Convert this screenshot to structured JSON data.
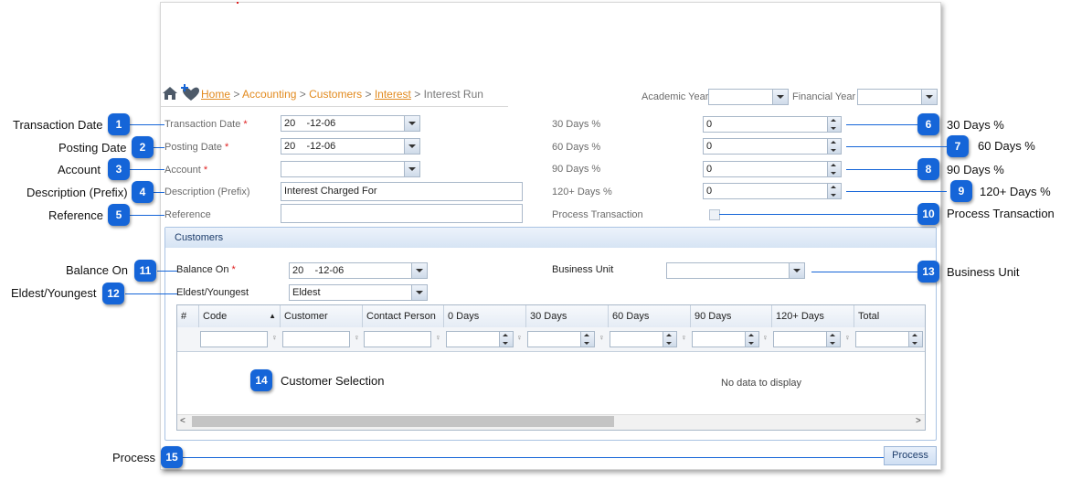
{
  "breadcrumb": {
    "home": "Home",
    "sep": ">",
    "accounting": "Accounting",
    "customers": "Customers",
    "interest": "Interest",
    "current": "Interest Run"
  },
  "header": {
    "academic_year_label": "Academic Year",
    "academic_year_value": "",
    "financial_year_label": "Financial Year",
    "financial_year_value": ""
  },
  "form": {
    "required_mark": "*",
    "transaction_date_label": "Transaction Date",
    "transaction_date_value": "20    -12-06",
    "posting_date_label": "Posting Date",
    "posting_date_value": "20    -12-06",
    "account_label": "Account",
    "account_value": "",
    "description_label": "Description (Prefix)",
    "description_value": "Interest Charged For",
    "reference_label": "Reference",
    "reference_value": "",
    "days30_label": "30 Days %",
    "days30_value": "0",
    "days60_label": "60 Days %",
    "days60_value": "0",
    "days90_label": "90 Days %",
    "days90_value": "0",
    "days120_label": "120+ Days %",
    "days120_value": "0",
    "process_transaction_label": "Process Transaction"
  },
  "customers": {
    "panel_title": "Customers",
    "balance_on_label": "Balance On",
    "balance_on_value": "20    -12-06",
    "eldest_label": "Eldest/Youngest",
    "eldest_value": "Eldest",
    "business_unit_label": "Business Unit",
    "business_unit_value": "",
    "columns": [
      "#",
      "Code",
      "Customer",
      "Contact Person",
      "0 Days",
      "30 Days",
      "60 Days",
      "90 Days",
      "120+ Days",
      "Total"
    ],
    "empty_text": "No data to display"
  },
  "process_button": "Process",
  "callouts": [
    {
      "num": "1",
      "text": "Transaction Date"
    },
    {
      "num": "2",
      "text": "Posting Date"
    },
    {
      "num": "3",
      "text": "Account"
    },
    {
      "num": "4",
      "text": "Description (Prefix)"
    },
    {
      "num": "5",
      "text": "Reference"
    },
    {
      "num": "6",
      "text": "30 Days %"
    },
    {
      "num": "7",
      "text": "60 Days %"
    },
    {
      "num": "8",
      "text": "90 Days %"
    },
    {
      "num": "9",
      "text": "120+ Days %"
    },
    {
      "num": "10",
      "text": "Process Transaction"
    },
    {
      "num": "11",
      "text": "Balance On"
    },
    {
      "num": "12",
      "text": "Eldest/Youngest"
    },
    {
      "num": "13",
      "text": "Business Unit"
    },
    {
      "num": "14",
      "text": "Customer Selection"
    },
    {
      "num": "15",
      "text": "Process"
    }
  ],
  "colors": {
    "accent": "#1565d8",
    "link": "#e28a1e",
    "required": "#e02020"
  }
}
